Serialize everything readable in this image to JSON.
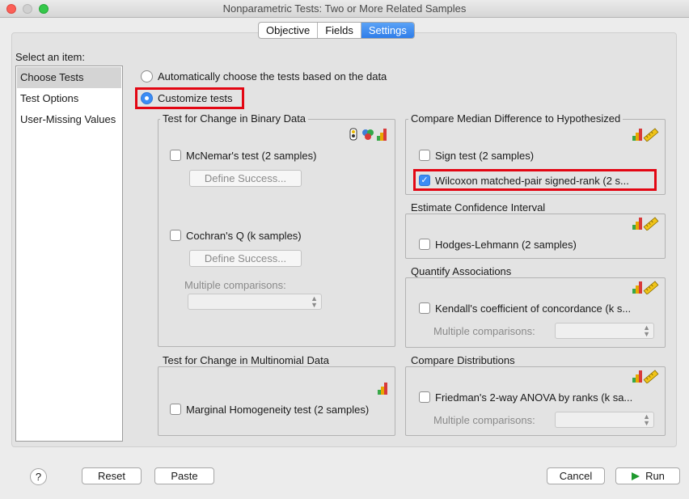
{
  "window": {
    "title": "Nonparametric Tests: Two or More Related Samples"
  },
  "tabs": [
    {
      "label": "Objective"
    },
    {
      "label": "Fields"
    },
    {
      "label": "Settings"
    }
  ],
  "sidebar": {
    "heading": "Select an item:",
    "items": [
      {
        "label": "Choose Tests"
      },
      {
        "label": "Test Options"
      },
      {
        "label": "User-Missing Values"
      }
    ]
  },
  "options": {
    "auto": "Automatically choose the tests based on the data",
    "custom": "Customize tests"
  },
  "binary": {
    "title": "Test for Change in Binary Data",
    "mcnemar": "McNemar's test (2 samples)",
    "define1": "Define Success...",
    "cochran": "Cochran's Q (k samples)",
    "define2": "Define Success...",
    "multiple": "Multiple comparisons:"
  },
  "multinomial": {
    "title": "Test for Change in Multinomial Data",
    "marginal": "Marginal Homogeneity test (2 samples)"
  },
  "median": {
    "title": "Compare Median Difference to Hypothesized",
    "sign": "Sign test (2 samples)",
    "wilcoxon": "Wilcoxon matched-pair signed-rank (2 s..."
  },
  "confidence": {
    "title": "Estimate Confidence Interval",
    "hodges": "Hodges-Lehmann (2 samples)"
  },
  "associations": {
    "title": "Quantify Associations",
    "kendall": "Kendall's coefficient of concordance (k s...",
    "multiple": "Multiple comparisons:"
  },
  "distributions": {
    "title": "Compare Distributions",
    "friedman": "Friedman's 2-way ANOVA by ranks (k sa...",
    "multiple": "Multiple comparisons:"
  },
  "footer": {
    "help": "?",
    "reset": "Reset",
    "paste": "Paste",
    "cancel": "Cancel",
    "run": "Run"
  },
  "colors": {
    "accent": "#3b8cf5",
    "highlight": "#e30613"
  }
}
